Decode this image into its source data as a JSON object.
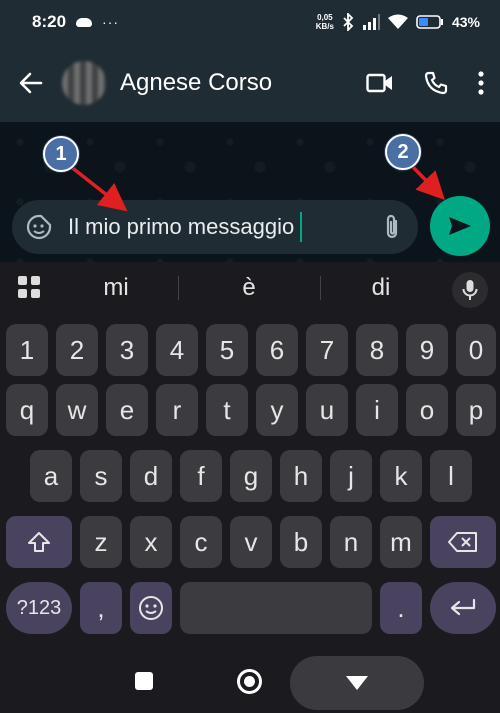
{
  "status_bar": {
    "time": "8:20",
    "dots": "···",
    "speed_top": "0,05",
    "speed_bottom": "KB/s",
    "battery_pct": "43%"
  },
  "header": {
    "contact_name": "Agnese Corso",
    "icons": [
      "back-arrow-icon",
      "video-call-icon",
      "phone-icon",
      "more-vert-icon"
    ]
  },
  "composer": {
    "message": "Il mio primo messaggio",
    "icons": [
      "sticker-icon",
      "attach-clip-icon",
      "send-icon"
    ]
  },
  "annotations": {
    "badge1": "1",
    "badge2": "2",
    "color": "#4a6fa5",
    "arrow_color": "#e02020"
  },
  "keyboard": {
    "suggestions": [
      "mi",
      "è",
      "di"
    ],
    "row_numbers": [
      "1",
      "2",
      "3",
      "4",
      "5",
      "6",
      "7",
      "8",
      "9",
      "0"
    ],
    "row1": [
      "q",
      "w",
      "e",
      "r",
      "t",
      "y",
      "u",
      "i",
      "o",
      "p"
    ],
    "row2": [
      "a",
      "s",
      "d",
      "f",
      "g",
      "h",
      "j",
      "k",
      "l"
    ],
    "row3": [
      "z",
      "x",
      "c",
      "v",
      "b",
      "n",
      "m"
    ],
    "symbols_label": "?123",
    "comma": ",",
    "period": "."
  },
  "colors": {
    "accent": "#00a884",
    "header_bg": "#1f2c33",
    "keyboard_bg": "#1b1b1f"
  }
}
